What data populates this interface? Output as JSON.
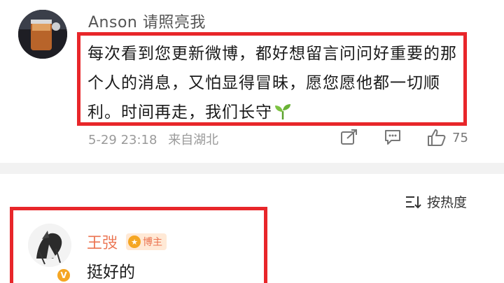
{
  "comment1": {
    "username": "Anson 请照亮我",
    "text": "每次看到您更新微博，都好想留言问问好重要的那个人的消息，又怕显得冒昧，愿您愿他都一切顺利。时间再走，我们长守",
    "timestamp": "5-29 23:18",
    "location": "来自湖北",
    "like_count": "75",
    "icons": [
      "share-icon",
      "comment-icon",
      "like-icon",
      "sprout-emoji"
    ]
  },
  "sort": {
    "label": "按热度",
    "icon": "sort-icon"
  },
  "comment2": {
    "username": "王弢",
    "badge": "博主",
    "text": "挺好的",
    "verified_mark": "V"
  },
  "colors": {
    "highlight_border": "#e8262a",
    "blogger_name": "#eb7350",
    "badge_gold": "#f5a623"
  }
}
